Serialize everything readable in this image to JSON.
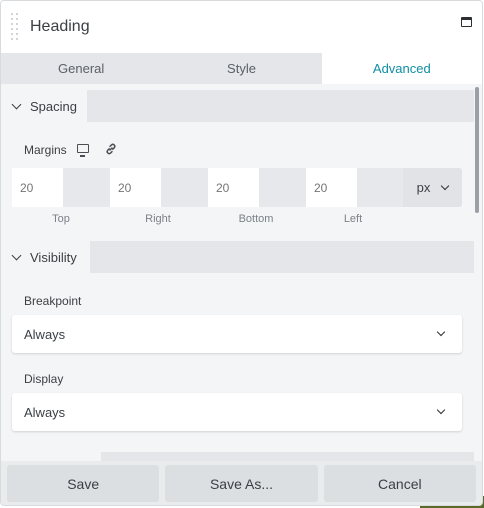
{
  "header": {
    "title": "Heading"
  },
  "tabs": [
    {
      "label": "General",
      "active": false
    },
    {
      "label": "Style",
      "active": false
    },
    {
      "label": "Advanced",
      "active": true
    }
  ],
  "spacing": {
    "section_label": "Spacing",
    "margins_label": "Margins",
    "values": {
      "top": "20",
      "right": "20",
      "bottom": "20",
      "left": "20"
    },
    "sublabels": {
      "top": "Top",
      "right": "Right",
      "bottom": "Bottom",
      "left": "Left"
    },
    "unit": "px"
  },
  "visibility": {
    "section_label": "Visibility",
    "breakpoint_label": "Breakpoint",
    "breakpoint_value": "Always",
    "display_label": "Display",
    "display_value": "Always"
  },
  "footer": {
    "save": "Save",
    "save_as": "Save As...",
    "cancel": "Cancel"
  },
  "colors": {
    "accent": "#0e8ea5",
    "panel_bg": "#f4f5f6",
    "tab_bg": "#e4e6e9"
  }
}
